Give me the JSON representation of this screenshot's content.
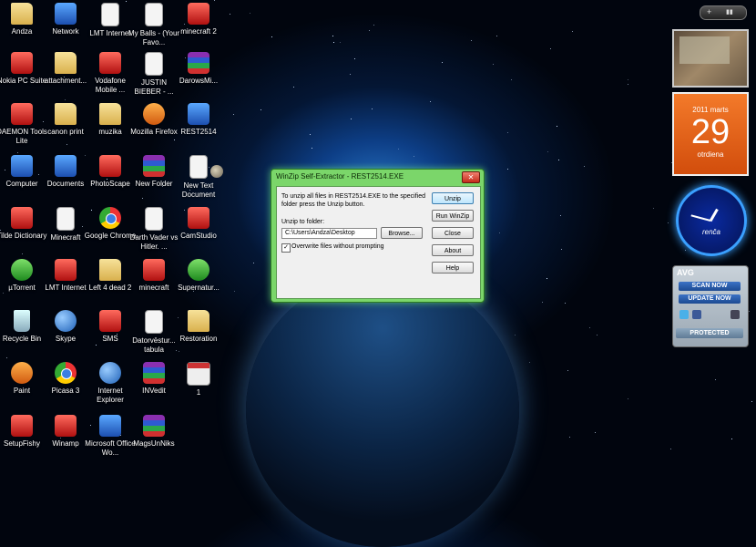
{
  "desktop": {
    "icons": [
      {
        "label": "Andza",
        "glyph": "folder-icon"
      },
      {
        "label": "Network",
        "glyph": "network-icon"
      },
      {
        "label": "LMT Internet",
        "glyph": "document-icon"
      },
      {
        "label": "My Balls - (Your Favo...",
        "glyph": "document-icon"
      },
      {
        "label": "minecraft 2",
        "glyph": "app-icon"
      },
      {
        "label": "Nokia PC Suite",
        "glyph": "app-icon"
      },
      {
        "label": "attachment...",
        "glyph": "folder-icon"
      },
      {
        "label": "Vodafone Mobile ...",
        "glyph": "app-icon"
      },
      {
        "label": "JUSTIN BIEBER - ...",
        "glyph": "document-icon"
      },
      {
        "label": "DarowsMi...",
        "glyph": "archive-icon"
      },
      {
        "label": "DAEMON Tools Lite",
        "glyph": "app-icon"
      },
      {
        "label": "canon print",
        "glyph": "folder-icon"
      },
      {
        "label": "muzika",
        "glyph": "folder-icon"
      },
      {
        "label": "Mozilla Firefox",
        "glyph": "firefox-icon"
      },
      {
        "label": "REST2514",
        "glyph": "installer-icon"
      },
      {
        "label": "Computer",
        "glyph": "computer-icon"
      },
      {
        "label": "Documents",
        "glyph": "documents-icon"
      },
      {
        "label": "PhotoScape",
        "glyph": "app-icon"
      },
      {
        "label": "New Folder",
        "glyph": "archive-icon"
      },
      {
        "label": "New Text Document",
        "glyph": "document-icon"
      },
      {
        "label": "Tilde Dictionary",
        "glyph": "app-icon"
      },
      {
        "label": "Minecraft",
        "glyph": "document-icon"
      },
      {
        "label": "Google Chrome",
        "glyph": "chrome-icon"
      },
      {
        "label": "Darth Vader vs Hitler. ...",
        "glyph": "document-icon"
      },
      {
        "label": "CamStudio",
        "glyph": "app-icon"
      },
      {
        "label": "µTorrent",
        "glyph": "utorrent-icon"
      },
      {
        "label": "LMT Internet",
        "glyph": "app-icon"
      },
      {
        "label": "Left 4 dead 2",
        "glyph": "folder-icon"
      },
      {
        "label": "minecraft",
        "glyph": "app-icon"
      },
      {
        "label": "Supernatur...",
        "glyph": "utorrent-icon"
      },
      {
        "label": "Recycle Bin",
        "glyph": "recycle-bin-icon"
      },
      {
        "label": "Skype",
        "glyph": "skype-icon"
      },
      {
        "label": "SMS",
        "glyph": "app-icon"
      },
      {
        "label": "Datorvēstur... tabula",
        "glyph": "document-icon"
      },
      {
        "label": "Restoration",
        "glyph": "folder-icon"
      },
      {
        "label": "Paint",
        "glyph": "paint-icon"
      },
      {
        "label": "Picasa 3",
        "glyph": "picasa-icon"
      },
      {
        "label": "Internet Explorer",
        "glyph": "ie-icon"
      },
      {
        "label": "INVedit",
        "glyph": "archive-icon"
      },
      {
        "label": "1",
        "glyph": "calendar-file-icon"
      },
      {
        "label": "SetupFishy",
        "glyph": "app-icon"
      },
      {
        "label": "Winamp",
        "glyph": "app-icon"
      },
      {
        "label": "Microsoft Office Wo...",
        "glyph": "word-icon"
      },
      {
        "label": "MagsUnNiks",
        "glyph": "archive-icon"
      }
    ]
  },
  "dialog": {
    "title": "WinZip Self-Extractor - REST2514.EXE",
    "close_glyph": "✕",
    "message": "To unzip all files in REST2514.EXE to the specified folder press the Unzip button.",
    "folder_label": "Unzip to folder:",
    "folder_value": "C:\\Users\\Andza\\Desktop",
    "browse_label": "Browse...",
    "overwrite_label": "Overwrite files without prompting",
    "overwrite_checked": true,
    "buttons": {
      "unzip": "Unzip",
      "run_winzip": "Run WinZip",
      "close": "Close",
      "about": "About",
      "help": "Help"
    }
  },
  "gadgets": {
    "controls": {
      "add": "+",
      "nav": "▮▮"
    },
    "calendar": {
      "month": "2011 marts",
      "day": "29",
      "weekday": "otrdiena"
    },
    "clock": {
      "signature": "renča"
    },
    "avg": {
      "logo": "AVG",
      "scan": "SCAN NOW",
      "update": "UPDATE NOW",
      "status": "PROTECTED"
    }
  }
}
